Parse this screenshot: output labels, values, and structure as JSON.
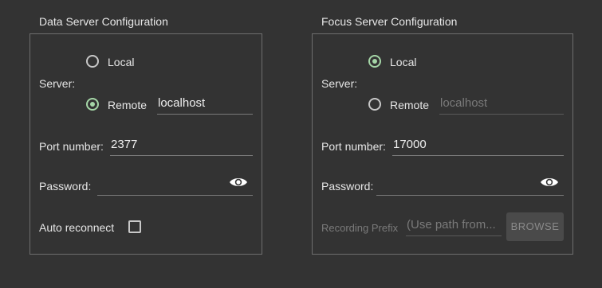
{
  "data_server": {
    "title": "Data Server Configuration",
    "server_label": "Server:",
    "local_label": "Local",
    "remote_label": "Remote",
    "selected": "remote",
    "remote_host": "localhost",
    "port_label": "Port number:",
    "port_value": "2377",
    "password_label": "Password:",
    "password_value": "",
    "auto_reconnect_label": "Auto reconnect",
    "auto_reconnect_checked": false
  },
  "focus_server": {
    "title": "Focus Server Configuration",
    "server_label": "Server:",
    "local_label": "Local",
    "remote_label": "Remote",
    "selected": "local",
    "remote_host": "localhost",
    "port_label": "Port number:",
    "port_value": "17000",
    "password_label": "Password:",
    "password_value": "",
    "recording_prefix_label": "Recording Prefix",
    "recording_prefix_placeholder": "(Use path from...",
    "browse_label": "BROWSE"
  },
  "colors": {
    "background": "#333333",
    "radio_checked": "#a5d6a7",
    "border": "#6e6e6e"
  },
  "icons": {
    "password_toggle": "eye-icon"
  }
}
